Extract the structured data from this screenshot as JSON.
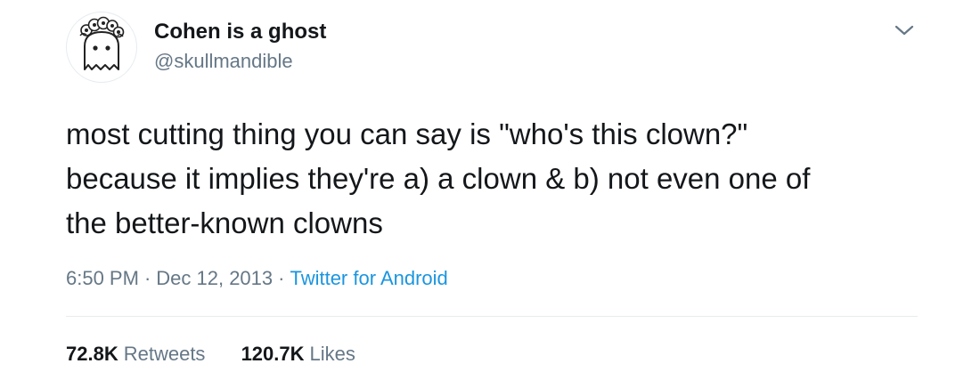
{
  "author": {
    "display_name": "Cohen is a ghost",
    "handle": "@skullmandible",
    "avatar_icon": "ghost-with-flower-crown-icon"
  },
  "menu": {
    "icon": "chevron-down-icon"
  },
  "tweet": {
    "text_lines": [
      "most cutting thing you can say is \"who's this clown?\"",
      "because it implies they're a) a clown & b) not even one of",
      "the better-known clowns"
    ]
  },
  "meta": {
    "time": "6:50 PM",
    "separator": "·",
    "date": "Dec 12, 2013",
    "source": "Twitter for Android"
  },
  "stats": {
    "retweets_count": "72.8K",
    "retweets_label": "Retweets",
    "likes_count": "120.7K",
    "likes_label": "Likes"
  },
  "colors": {
    "text_primary": "#14171a",
    "text_secondary": "#657786",
    "link_blue": "#1b95e0",
    "divider": "#e6ecf0"
  }
}
